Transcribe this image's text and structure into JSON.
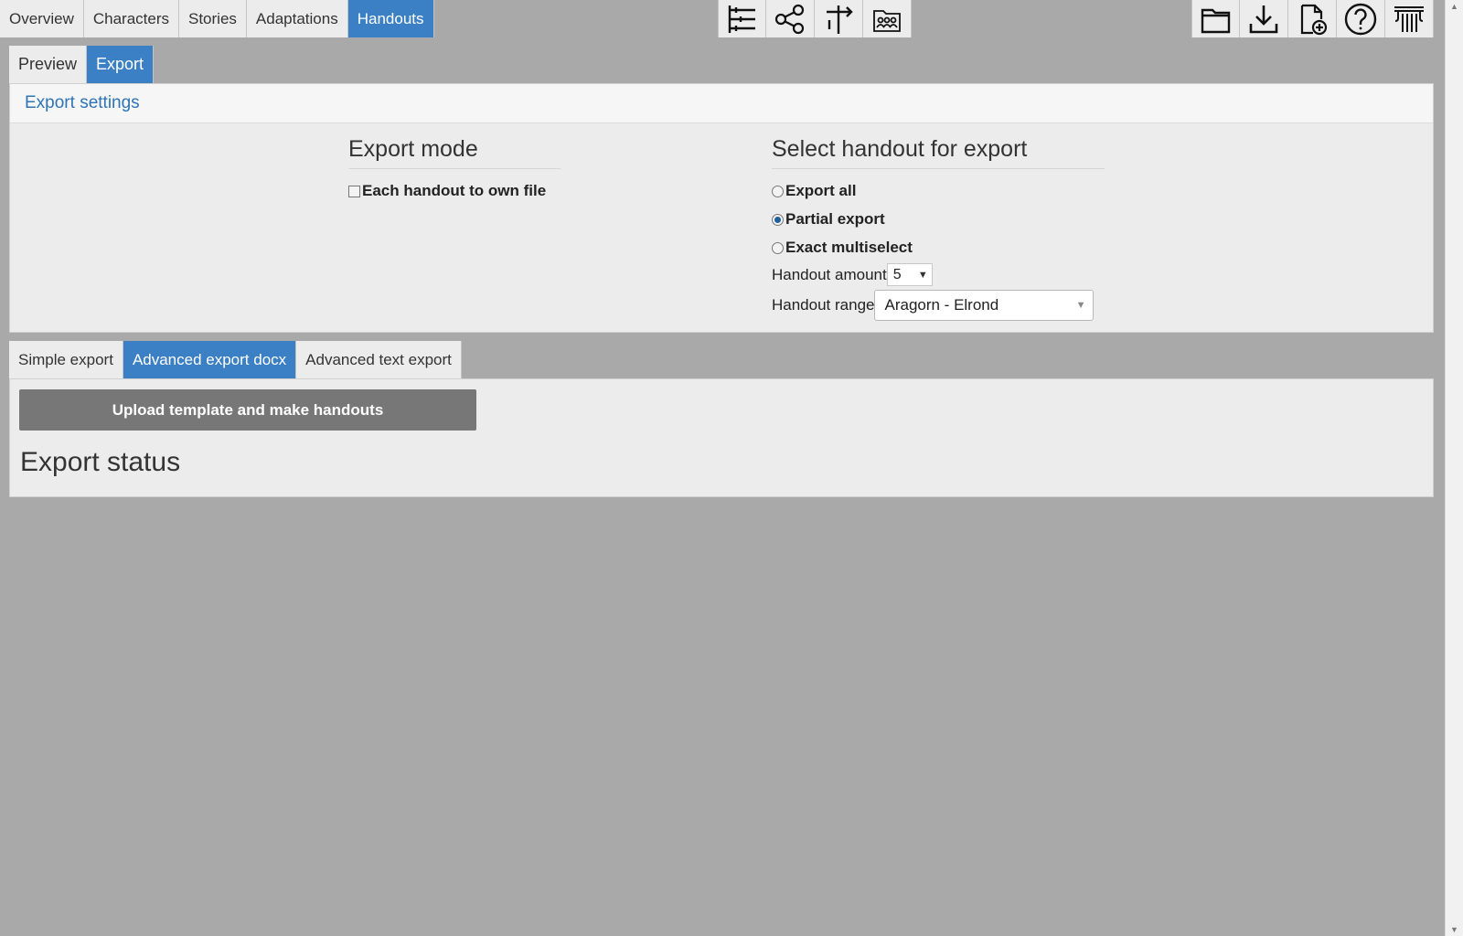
{
  "top_tabs": [
    {
      "label": "Overview",
      "active": false
    },
    {
      "label": "Characters",
      "active": false
    },
    {
      "label": "Stories",
      "active": false
    },
    {
      "label": "Adaptations",
      "active": false
    },
    {
      "label": "Handouts",
      "active": true
    }
  ],
  "center_icons": [
    "timeline-list-icon",
    "share-nodes-icon",
    "signpost-icon",
    "group-folder-icon"
  ],
  "right_icons": [
    "open-folder-icon",
    "download-icon",
    "new-file-icon",
    "help-icon",
    "logo-column-icon"
  ],
  "sub_tabs": [
    {
      "label": "Preview",
      "active": false
    },
    {
      "label": "Export",
      "active": true
    }
  ],
  "settings": {
    "title": "Export settings",
    "mode": {
      "heading": "Export mode",
      "checkbox_label": "Each handout to own file",
      "checked": false
    },
    "select": {
      "heading": "Select handout for export",
      "options": [
        {
          "label": "Export all",
          "checked": false
        },
        {
          "label": "Partial export",
          "checked": true
        },
        {
          "label": "Exact multiselect",
          "checked": false
        }
      ],
      "amount_label": "Handout amount",
      "amount_value": "5",
      "range_label": "Handout range",
      "range_value": "Aragorn - Elrond"
    }
  },
  "export_tabs": [
    {
      "label": "Simple export",
      "active": false
    },
    {
      "label": "Advanced export docx",
      "active": true
    },
    {
      "label": "Advanced text export",
      "active": false
    }
  ],
  "export": {
    "upload_button": "Upload template and make handouts",
    "status_title": "Export status"
  },
  "colors": {
    "accent": "#3b7fc4",
    "background": "#a9a9a9",
    "link": "#2f74b5"
  }
}
